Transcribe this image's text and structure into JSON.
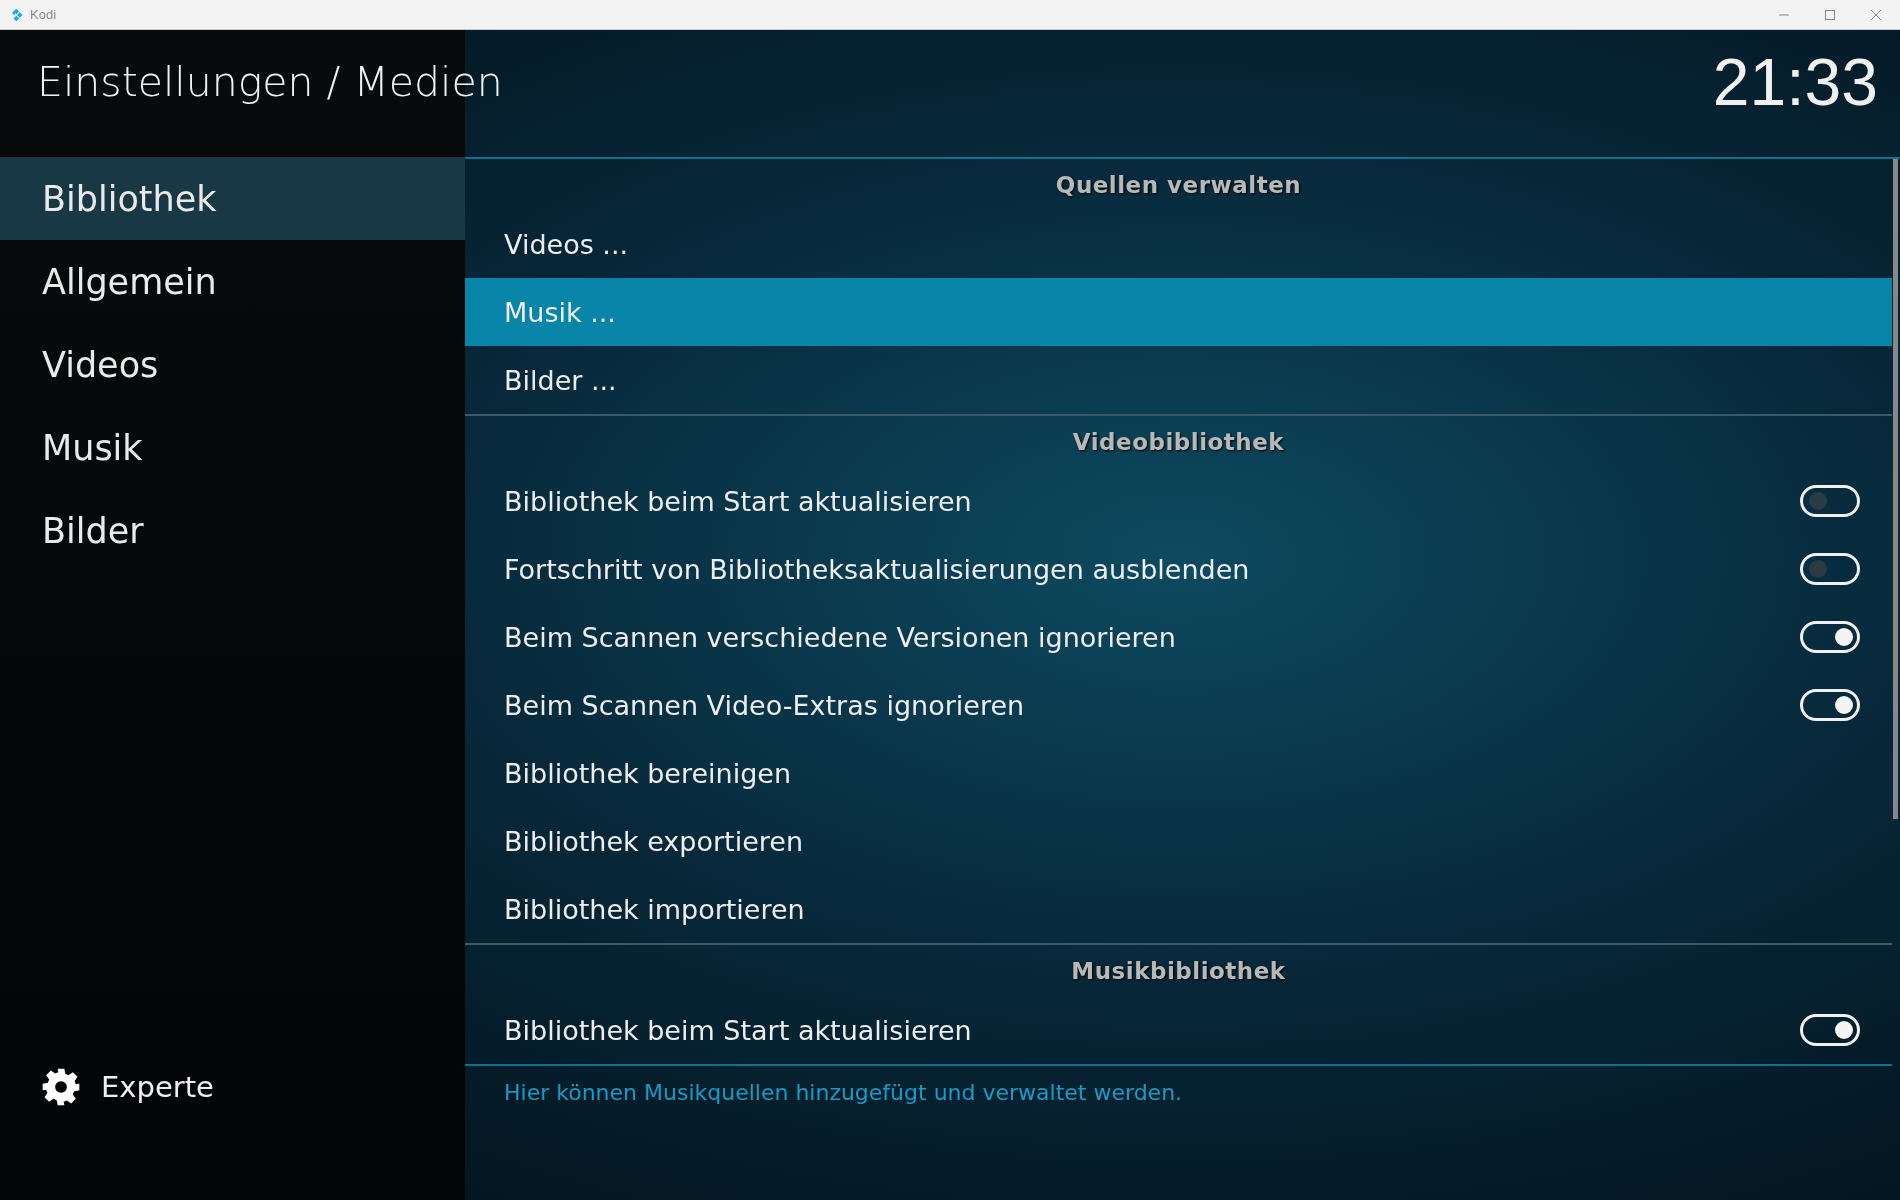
{
  "window": {
    "title": "Kodi"
  },
  "header": {
    "title": "Einstellungen / Medien",
    "clock": "21:33"
  },
  "sidebar": {
    "items": [
      {
        "label": "Bibliothek",
        "selected": true
      },
      {
        "label": "Allgemein",
        "selected": false
      },
      {
        "label": "Videos",
        "selected": false
      },
      {
        "label": "Musik",
        "selected": false
      },
      {
        "label": "Bilder",
        "selected": false
      }
    ],
    "footer": {
      "label": "Experte"
    }
  },
  "sections": [
    {
      "title": "Quellen verwalten",
      "rows": [
        {
          "kind": "action",
          "label": "Videos ...",
          "selected": false
        },
        {
          "kind": "action",
          "label": "Musik ...",
          "selected": true
        },
        {
          "kind": "action",
          "label": "Bilder ...",
          "selected": false
        }
      ]
    },
    {
      "title": "Videobibliothek",
      "rows": [
        {
          "kind": "toggle",
          "label": "Bibliothek beim Start aktualisieren",
          "selected": false,
          "on": false
        },
        {
          "kind": "toggle",
          "label": "Fortschritt von Bibliotheksaktualisierungen ausblenden",
          "selected": false,
          "on": false
        },
        {
          "kind": "toggle",
          "label": "Beim Scannen verschiedene Versionen ignorieren",
          "selected": false,
          "on": true
        },
        {
          "kind": "toggle",
          "label": "Beim Scannen Video-Extras ignorieren",
          "selected": false,
          "on": true
        },
        {
          "kind": "action",
          "label": "Bibliothek bereinigen",
          "selected": false
        },
        {
          "kind": "action",
          "label": "Bibliothek exportieren",
          "selected": false
        },
        {
          "kind": "action",
          "label": "Bibliothek importieren",
          "selected": false
        }
      ]
    },
    {
      "title": "Musikbibliothek",
      "rows": [
        {
          "kind": "toggle",
          "label": "Bibliothek beim Start aktualisieren",
          "selected": false,
          "on": true
        }
      ]
    }
  ],
  "help_text": "Hier können Musikquellen hinzugefügt und verwaltet werden."
}
